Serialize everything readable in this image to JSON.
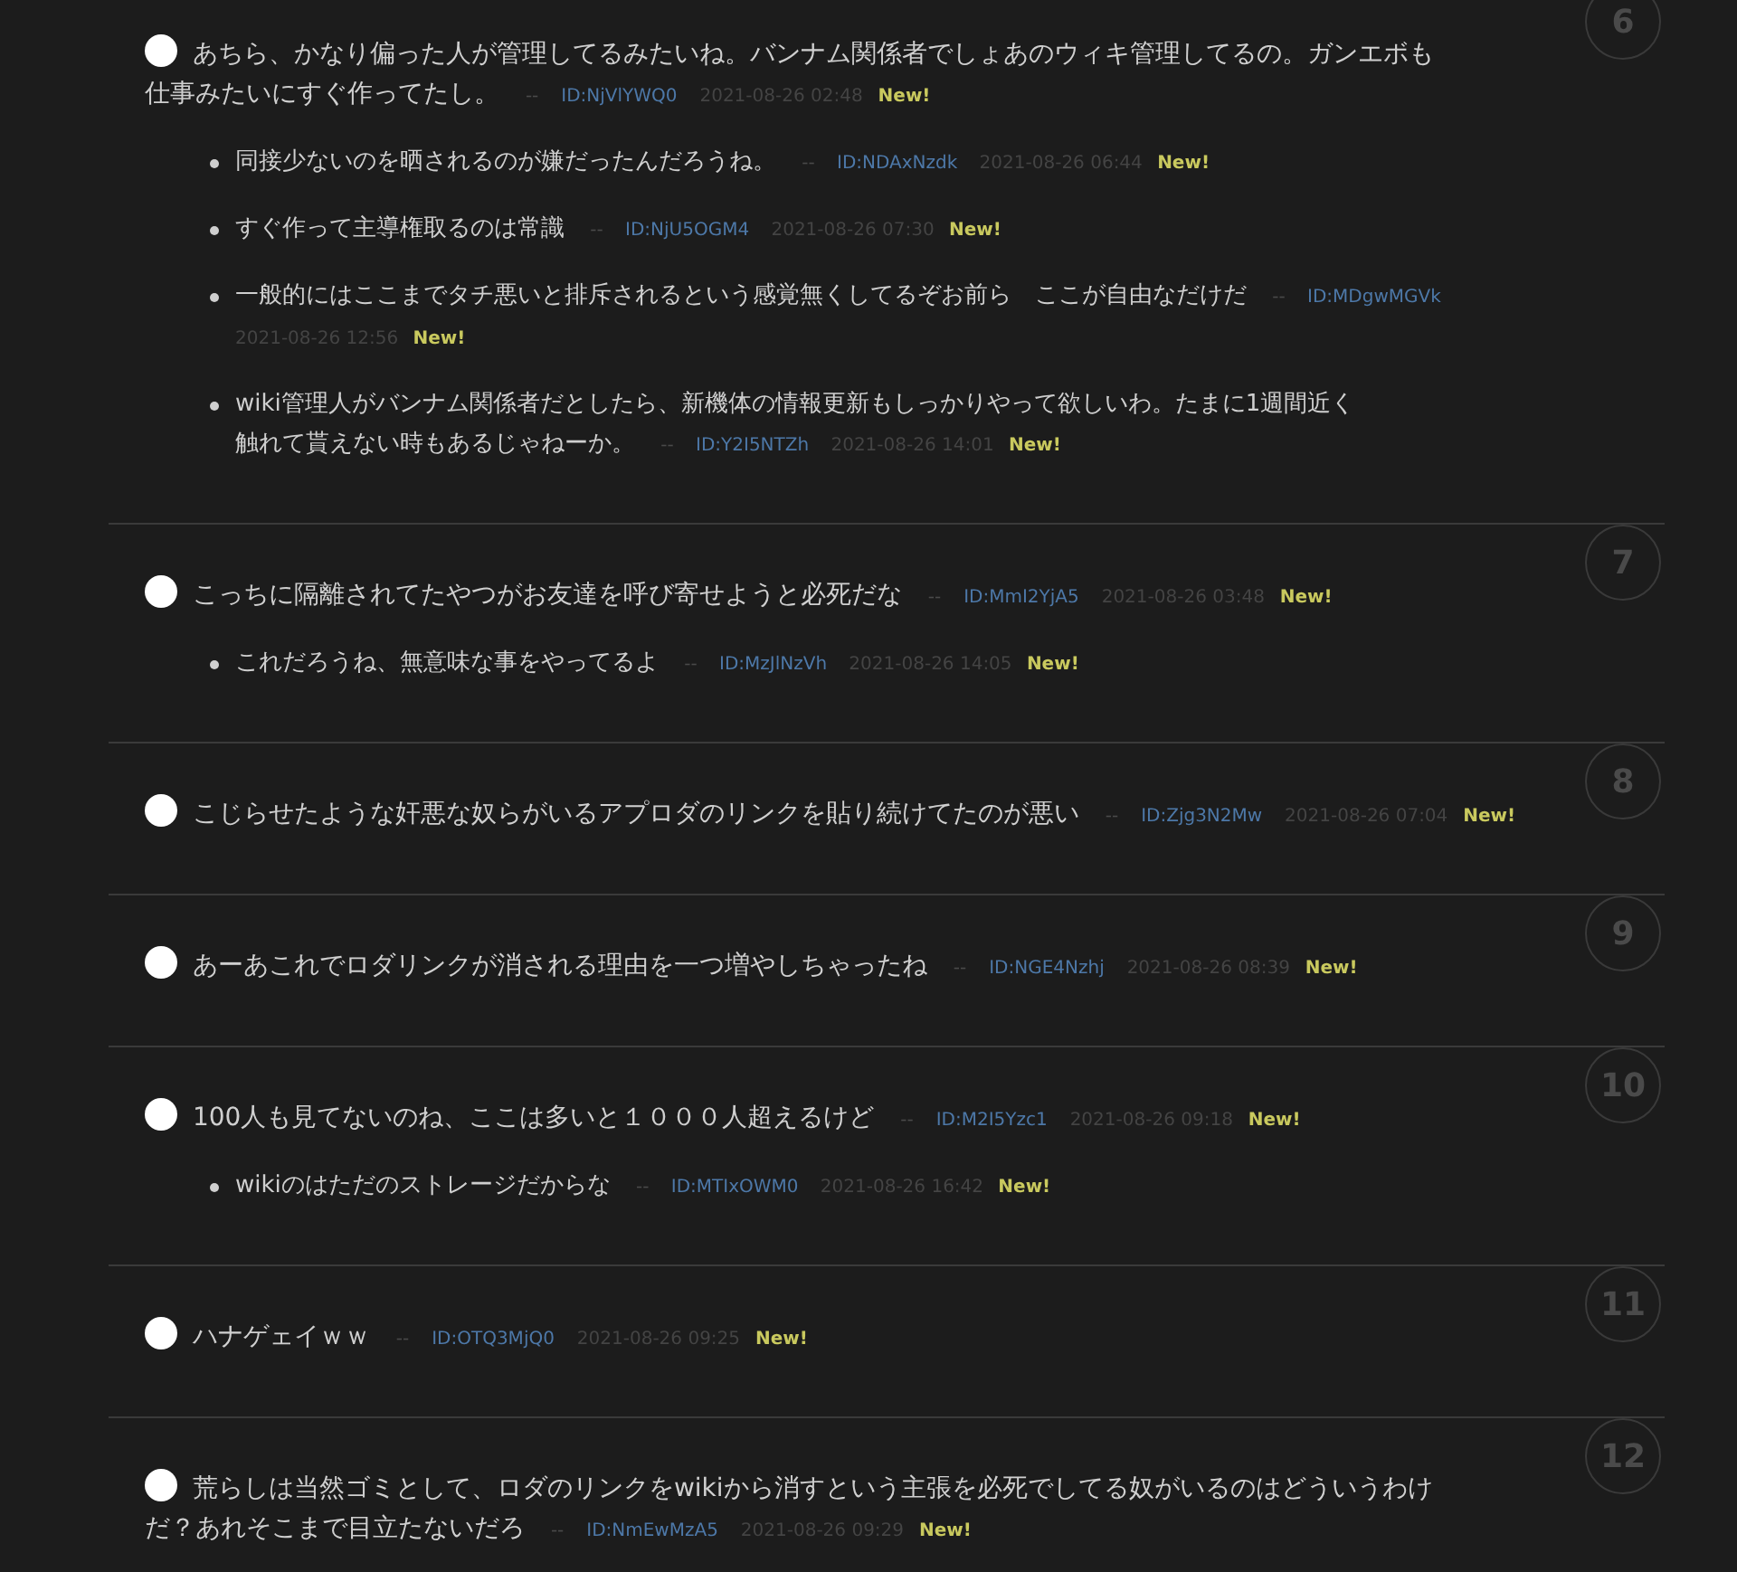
{
  "posts": [
    {
      "number": "6",
      "lines": [
        "あちら、かなり偏った人が管理してるみたいね。バンナム関係者でしょあのウィキ管理してるの。ガンエボも",
        "仕事みたいにすぐ作ってたし。"
      ],
      "sep": "--",
      "id": "ID:NjVlYWQ0",
      "date": "2021-08-26 02:48",
      "badge": "New!",
      "replies": [
        {
          "lines": [
            "同接少ないのを晒されるのが嫌だったんだろうね。"
          ],
          "sep": "--",
          "id": "ID:NDAxNzdk",
          "date": "2021-08-26 06:44",
          "badge": "New!"
        },
        {
          "lines": [
            "すぐ作って主導権取るのは常識"
          ],
          "sep": "--",
          "id": "ID:NjU5OGM4",
          "date": "2021-08-26 07:30",
          "badge": "New!"
        },
        {
          "lines": [
            "一般的にはここまでタチ悪いと排斥されるという感覚無くしてるぞお前ら　ここが自由なだけだ"
          ],
          "sep": "--",
          "id": "ID:MDgwMGVk",
          "date": "2021-08-26 12:56",
          "badge": "New!"
        },
        {
          "lines": [
            "wiki管理人がバンナム関係者だとしたら、新機体の情報更新もしっかりやって欲しいわ。たまに1週間近く",
            "触れて貰えない時もあるじゃねーか。"
          ],
          "sep": "--",
          "id": "ID:Y2I5NTZh",
          "date": "2021-08-26 14:01",
          "badge": "New!"
        }
      ]
    },
    {
      "number": "7",
      "lines": [
        "こっちに隔離されてたやつがお友達を呼び寄せようと必死だな"
      ],
      "sep": "--",
      "id": "ID:MmI2YjA5",
      "date": "2021-08-26 03:48",
      "badge": "New!",
      "replies": [
        {
          "lines": [
            "これだろうね、無意味な事をやってるよ"
          ],
          "sep": "--",
          "id": "ID:MzJlNzVh",
          "date": "2021-08-26 14:05",
          "badge": "New!"
        }
      ]
    },
    {
      "number": "8",
      "lines": [
        "こじらせたような奸悪な奴らがいるアプロダのリンクを貼り続けてたのが悪い"
      ],
      "sep": "--",
      "id": "ID:Zjg3N2Mw",
      "date": "2021-08-26 07:04",
      "badge": "New!"
    },
    {
      "number": "9",
      "lines": [
        "あーあこれでロダリンクが消される理由を一つ増やしちゃったね"
      ],
      "sep": "--",
      "id": "ID:NGE4Nzhj",
      "date": "2021-08-26 08:39",
      "badge": "New!"
    },
    {
      "number": "10",
      "lines": [
        "100人も見てないのね、ここは多いと１０００人超えるけど"
      ],
      "sep": "--",
      "id": "ID:M2I5Yzc1",
      "date": "2021-08-26 09:18",
      "badge": "New!",
      "replies": [
        {
          "lines": [
            "wikiのはただのストレージだからな"
          ],
          "sep": "--",
          "id": "ID:MTIxOWM0",
          "date": "2021-08-26 16:42",
          "badge": "New!"
        }
      ]
    },
    {
      "number": "11",
      "lines": [
        "ハナゲェイｗｗ"
      ],
      "sep": "--",
      "id": "ID:OTQ3MjQ0",
      "date": "2021-08-26 09:25",
      "badge": "New!"
    },
    {
      "number": "12",
      "lines": [
        "荒らしは当然ゴミとして、ロダのリンクをwikiから消すという主張を必死でしてる奴がいるのはどういうわけ",
        "だ？あれそこまで目立たないだろ"
      ],
      "sep": "--",
      "id": "ID:NmEwMzA5",
      "date": "2021-08-26 09:29",
      "badge": "New!"
    }
  ]
}
